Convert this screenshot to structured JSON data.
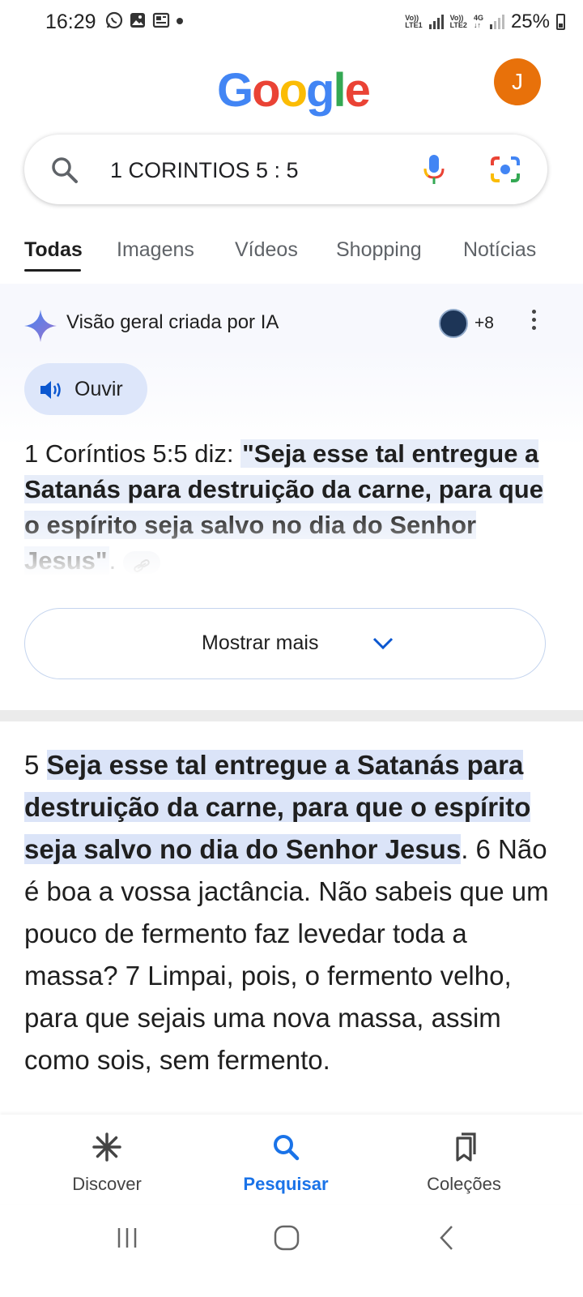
{
  "status_bar": {
    "time": "16:29",
    "sim1": "LTE1",
    "sim2": "LTE2",
    "volte": "Vo))",
    "network": "4G",
    "battery": "25%"
  },
  "header": {
    "logo": "Google",
    "avatar_initial": "J"
  },
  "search": {
    "query": "1 CORINTIOS 5 : 5"
  },
  "tabs": [
    "Todas",
    "Imagens",
    "Vídeos",
    "Shopping",
    "Notícias"
  ],
  "ai_overview": {
    "title": "Visão geral criada por IA",
    "sources_more": "+8",
    "listen_label": "Ouvir",
    "text_prefix": "1 Coríntios 5:5 diz: ",
    "text_quote": "\"Seja esse tal entregue a Satanás para destruição da carne, para que o espírito seja salvo no dia do Senhor Jesus\"",
    "text_suffix": ".",
    "show_more_label": "Mostrar mais"
  },
  "result": {
    "prefix": "5 ",
    "highlight": "Seja esse tal entregue a Satanás para destruição da carne, para que o espírito seja salvo no dia do Senhor Jesus",
    "rest": ". 6 Não é boa a vossa jactância. Não sabeis que um pouco de fermento faz levedar toda a massa? 7 Limpai, pois, o fermento velho, para que sejais uma nova massa, assim como sois, sem fermento."
  },
  "bottom_nav": {
    "discover": "Discover",
    "search": "Pesquisar",
    "collections": "Coleções"
  },
  "colors": {
    "accent": "#1a73e8",
    "avatar": "#e8710a",
    "highlight": "#dbe4f8"
  }
}
